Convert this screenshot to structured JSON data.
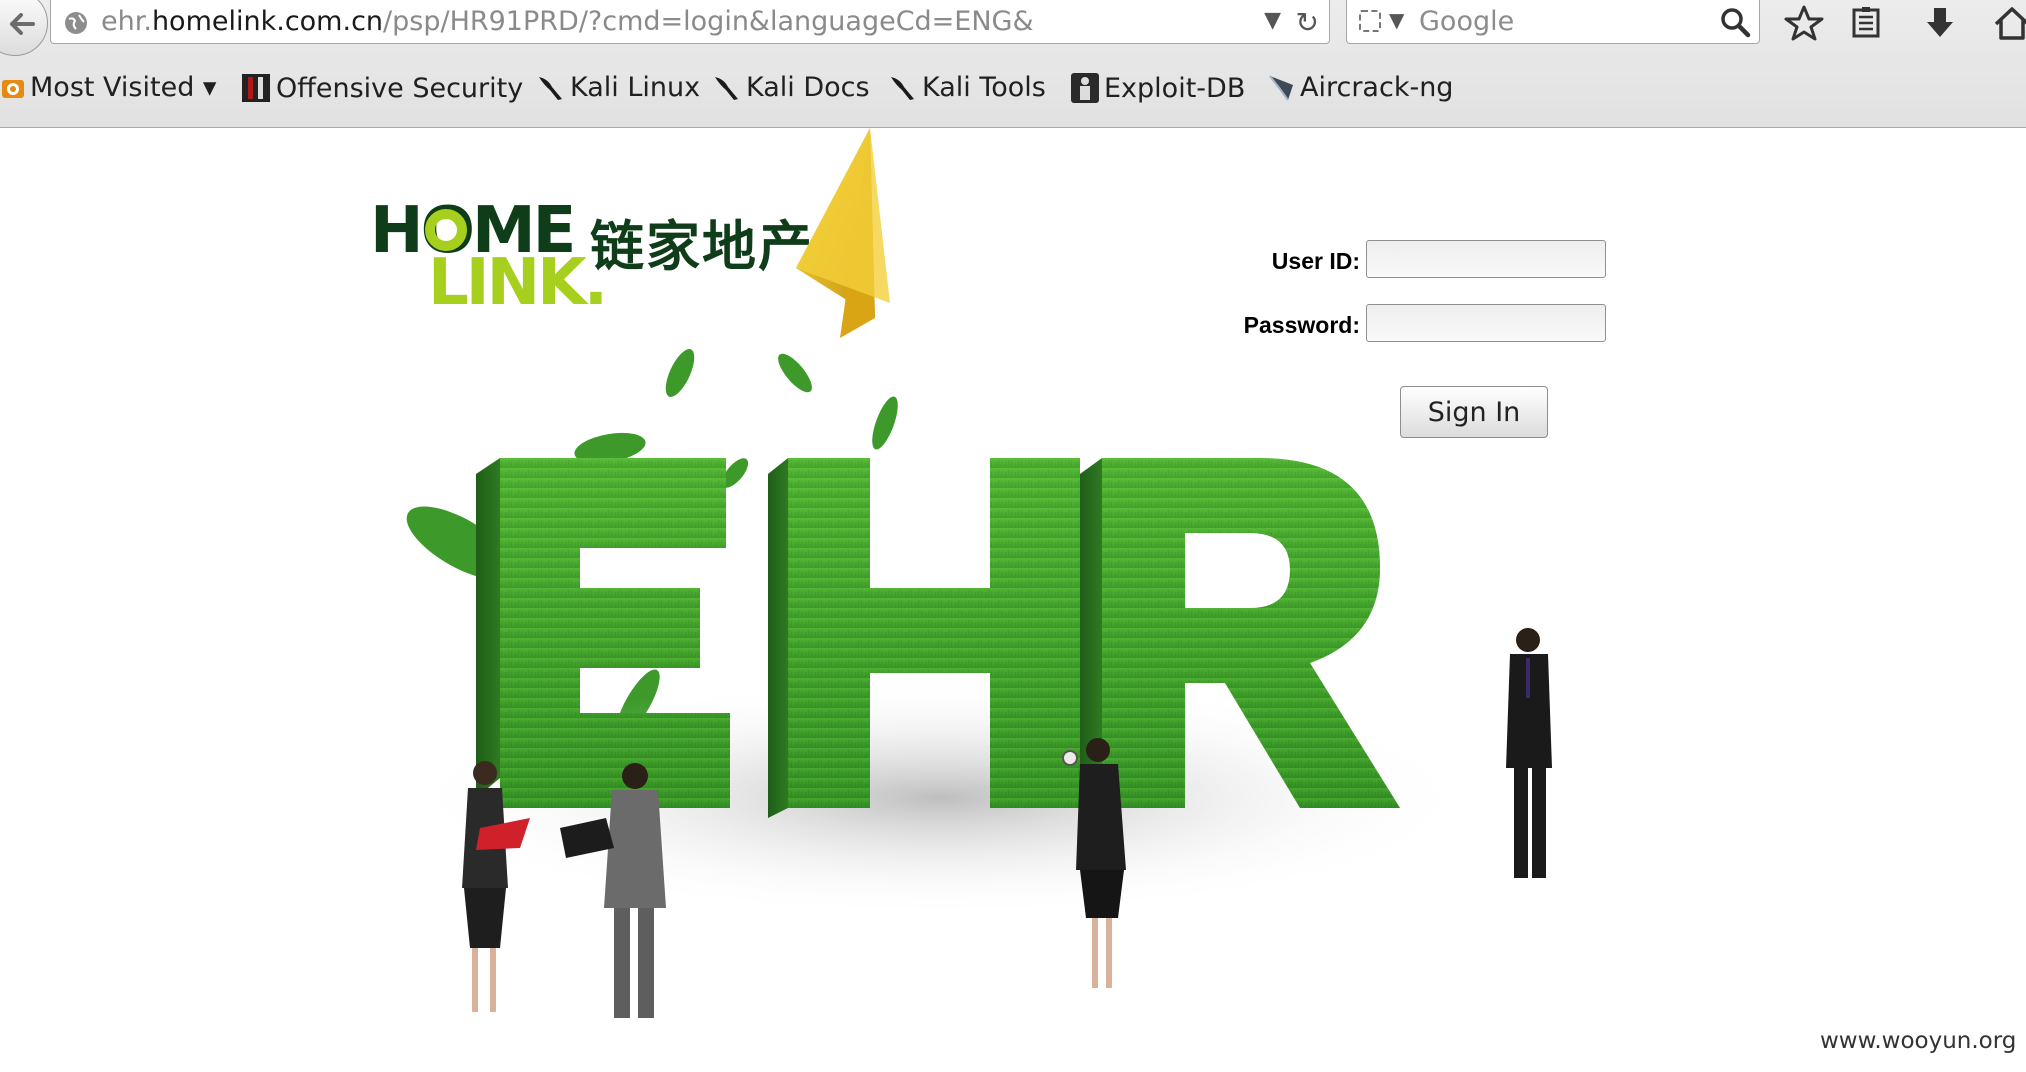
{
  "browser": {
    "url_prefix": "ehr.",
    "url_host": "homelink.com.cn",
    "url_path": "/psp/HR91PRD/?cmd=login&languageCd=ENG&",
    "search_placeholder": "Google",
    "bookmarks": [
      {
        "label": "Most Visited ▾",
        "icon": "most-visited-icon"
      },
      {
        "label": "Offensive Security",
        "icon": "offensive-security-icon"
      },
      {
        "label": "Kali Linux",
        "icon": "kali-dragon-icon"
      },
      {
        "label": "Kali Docs",
        "icon": "kali-dragon-icon"
      },
      {
        "label": "Kali Tools",
        "icon": "kali-dragon-icon"
      },
      {
        "label": "Exploit-DB",
        "icon": "exploit-db-icon"
      },
      {
        "label": "Aircrack-ng",
        "icon": "aircrack-icon"
      }
    ]
  },
  "logo": {
    "line1": "HOME",
    "line2": "LINK.",
    "chinese": "链家地产"
  },
  "hero": {
    "text": "EHR"
  },
  "login": {
    "userid_label": "User ID:",
    "password_label": "Password:",
    "userid_value": "",
    "password_value": "",
    "signin_label": "Sign In"
  },
  "watermark": "www.wooyun.org",
  "colors": {
    "logo_dark": "#0f3d1a",
    "logo_lime": "#a6cf1e",
    "grass": "#3f9a2a",
    "plane": "#e5b812"
  }
}
